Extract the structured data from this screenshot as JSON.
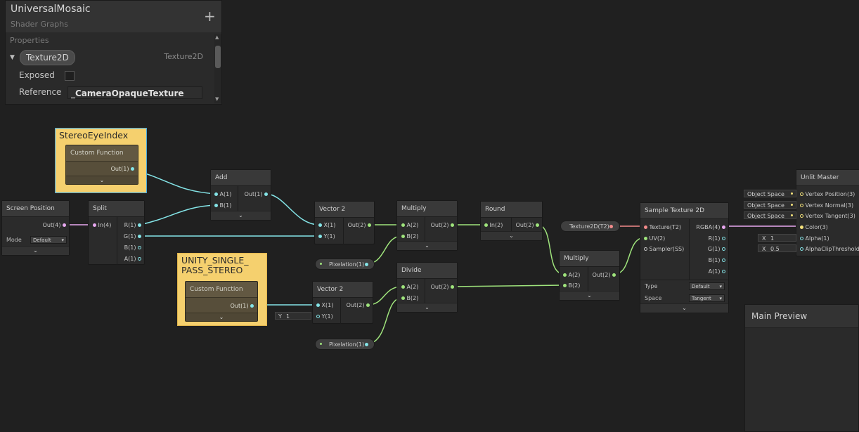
{
  "blackboard": {
    "title": "UniversalMosaic",
    "subtitle": "Shader Graphs",
    "add_icon": "plus-icon",
    "section": "Properties",
    "property": {
      "name": "Texture2D",
      "type": "Texture2D"
    },
    "exposed_label": "Exposed",
    "reference_label": "Reference",
    "reference_value": "_CameraOpaqueTexture"
  },
  "groups": {
    "g1": {
      "title": "StereoEyeIndex"
    },
    "g2": {
      "title_line1": "UNITY_SINGLE_",
      "title_line2": "PASS_STEREO"
    }
  },
  "nodes": {
    "custom_function_1": {
      "title": "Custom Function",
      "ports": {
        "out": "Out(1)"
      }
    },
    "custom_function_2": {
      "title": "Custom Function",
      "ports": {
        "out": "Out(1)"
      }
    },
    "screen_position": {
      "title": "Screen Position",
      "ports": {
        "out": "Out(4)"
      },
      "mode_label": "Mode",
      "mode_value": "Default"
    },
    "split": {
      "title": "Split",
      "ports": {
        "in": "In(4)",
        "r": "R(1)",
        "g": "G(1)",
        "b": "B(1)",
        "a": "A(1)"
      }
    },
    "add": {
      "title": "Add",
      "ports": {
        "a": "A(1)",
        "b": "B(1)",
        "out": "Out(1)"
      }
    },
    "vector2_1": {
      "title": "Vector 2",
      "ports": {
        "x": "X(1)",
        "y": "Y(1)",
        "out": "Out(2)"
      }
    },
    "vector2_2": {
      "title": "Vector 2",
      "ports": {
        "x": "X(1)",
        "y": "Y(1)",
        "out": "Out(2)"
      },
      "y_field_label": "Y",
      "y_field_value": "1"
    },
    "multiply_1": {
      "title": "Multiply",
      "ports": {
        "a": "A(2)",
        "b": "B(2)",
        "out": "Out(2)"
      }
    },
    "divide": {
      "title": "Divide",
      "ports": {
        "a": "A(2)",
        "b": "B(2)",
        "out": "Out(2)"
      }
    },
    "round": {
      "title": "Round",
      "ports": {
        "in": "In(2)",
        "out": "Out(2)"
      }
    },
    "multiply_2": {
      "title": "Multiply",
      "ports": {
        "a": "A(2)",
        "b": "B(2)",
        "out": "Out(2)"
      }
    },
    "sample_texture": {
      "title": "Sample Texture 2D",
      "ports": {
        "texture": "Texture(T2)",
        "uv": "UV(2)",
        "sampler": "Sampler(SS)",
        "rgba": "RGBA(4)",
        "r": "R(1)",
        "g": "G(1)",
        "b": "B(1)",
        "a": "A(1)"
      },
      "type_label": "Type",
      "type_value": "Default",
      "space_label": "Space",
      "space_value": "Tangent"
    },
    "unlit_master": {
      "title": "Unlit Master",
      "ports": {
        "vpos": "Vertex Position(3)",
        "vnorm": "Vertex Normal(3)",
        "vtan": "Vertex Tangent(3)",
        "color": "Color(3)",
        "alpha": "Alpha(1)",
        "clip": "AlphaClipThreshold"
      },
      "space1": "Object Space",
      "space2": "Object Space",
      "space3": "Object Space",
      "alpha_label": "X",
      "alpha_value": "1",
      "clip_label": "X",
      "clip_value": "0.5"
    }
  },
  "properties": {
    "pixelation_1": "Pixelation(1)",
    "pixelation_2": "Pixelation(1)",
    "texture2d": "Texture2D(T2)"
  },
  "preview": {
    "title": "Main Preview"
  },
  "colors": {
    "float_port": "#84e4e7",
    "vector2_port": "#9fe47c",
    "vector4_port": "#e8a8f0",
    "texture_port": "#f28b8b",
    "group_bg": "#f5d06e"
  }
}
